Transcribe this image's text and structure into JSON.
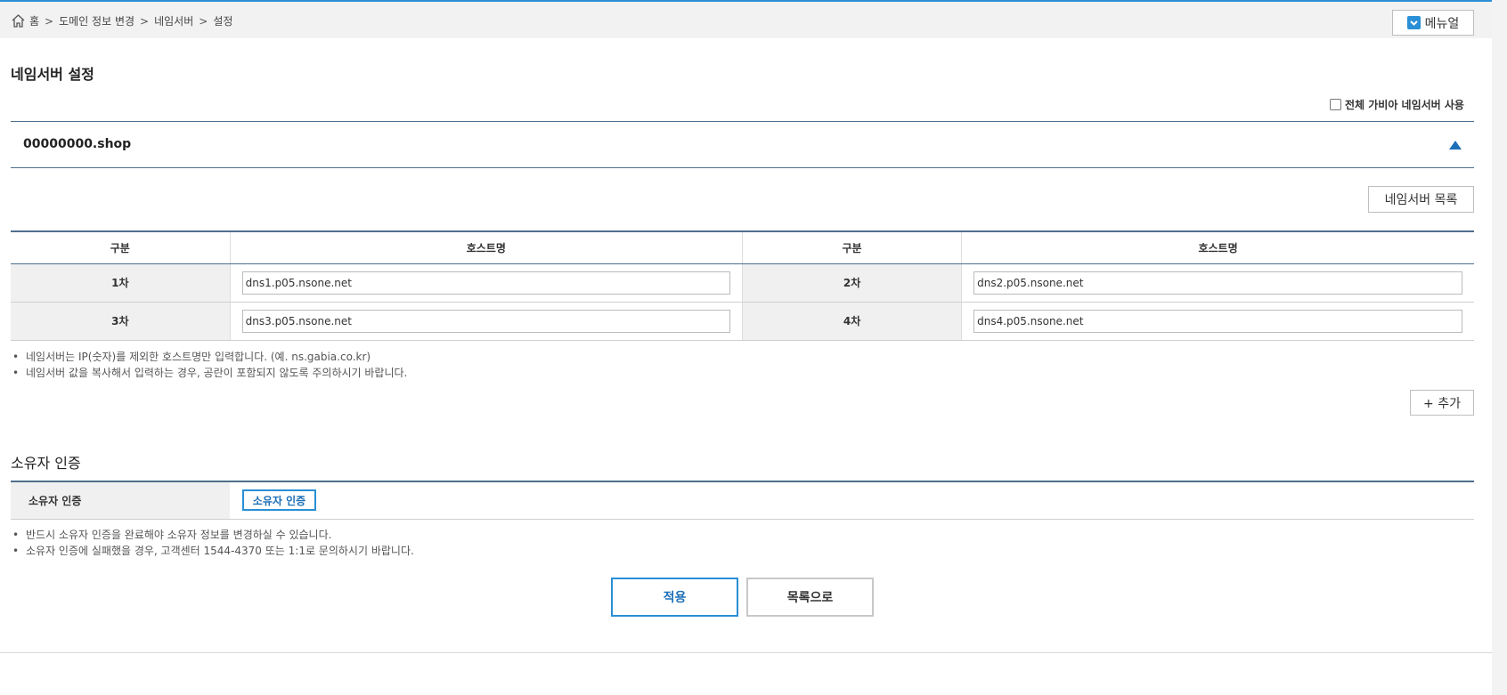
{
  "breadcrumb": {
    "home": "홈",
    "separator": ">",
    "items": [
      "도메인 정보 변경",
      "네임서버",
      "설정"
    ]
  },
  "header": {
    "manual_label": "메뉴얼"
  },
  "page_title": "네임서버 설정",
  "all_gabia_label": "전체 가비아 네임서버 사용",
  "domain": "00000000.shop",
  "ns_list_button": "네임서버 목록",
  "ns_table": {
    "headers": [
      "구분",
      "호스트명",
      "구분",
      "호스트명"
    ],
    "rows": [
      {
        "left_label": "1차",
        "left_value": "dns1.p05.nsone.net",
        "right_label": "2차",
        "right_value": "dns2.p05.nsone.net"
      },
      {
        "left_label": "3차",
        "left_value": "dns3.p05.nsone.net",
        "right_label": "4차",
        "right_value": "dns4.p05.nsone.net"
      }
    ]
  },
  "ns_notes": [
    "네임서버는 IP(숫자)를 제외한 호스트명만 입력합니다. (예. ns.gabia.co.kr)",
    "네임서버 값을 복사해서 입력하는 경우, 공란이 포함되지 않도록 주의하시기 바랍니다."
  ],
  "add_button": "+ 추가",
  "owner_section": {
    "title": "소유자 인증",
    "row_label": "소유자 인증",
    "button": "소유자 인증",
    "notes": [
      "반드시 소유자 인증을 완료해야 소유자 정보를 변경하실 수 있습니다.",
      "소유자 인증에 실패했을 경우, 고객센터 1544-4370 또는 1:1로 문의하시기 바랍니다."
    ]
  },
  "actions": {
    "apply": "적용",
    "back_to_list": "목록으로"
  },
  "colors": {
    "accent": "#2a8fd6",
    "table_border": "#4f6e8d",
    "label_bg": "#f0f0f0"
  },
  "icons": {
    "home": "home-icon",
    "manual": "checkbox-checked-icon",
    "collapse": "triangle-up-icon"
  }
}
